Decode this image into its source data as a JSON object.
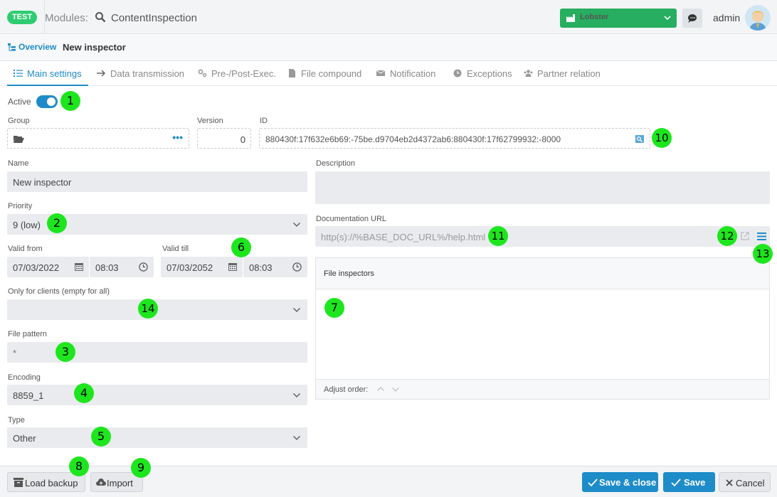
{
  "topbar": {
    "env_badge": "TEST",
    "modules_label": "Modules:",
    "module_name": "ContentInspection",
    "client_selector": "Lobster",
    "user_name": "admin"
  },
  "breadcrumb": {
    "overview": "Overview",
    "current": "New inspector"
  },
  "tabs": [
    {
      "label": "Main settings",
      "active": true
    },
    {
      "label": "Data transmission"
    },
    {
      "label": "Pre-/Post-Exec."
    },
    {
      "label": "File compound"
    },
    {
      "label": "Notification"
    },
    {
      "label": "Exceptions"
    },
    {
      "label": "Partner relation"
    }
  ],
  "form": {
    "active_label": "Active",
    "active": true,
    "group_label": "Group",
    "group_value": "",
    "version_label": "Version",
    "version_value": "0",
    "id_label": "ID",
    "id_value": "880430f:17f632e6b69:-75be.d9704eb2d4372ab6:880430f:17f62799932:-8000",
    "name_label": "Name",
    "name_value": "New inspector",
    "description_label": "Description",
    "description_value": "",
    "priority_label": "Priority",
    "priority_value": "9 (low)",
    "doc_url_label": "Documentation URL",
    "doc_url_placeholder": "http(s)://%BASE_DOC_URL%/help.html",
    "valid_from_label": "Valid from",
    "valid_from_date": "07/03/2022",
    "valid_from_time": "08:03",
    "valid_till_label": "Valid till",
    "valid_till_date": "07/03/2052",
    "valid_till_time": "08:03",
    "clients_label": "Only for clients (empty for all)",
    "clients_value": "",
    "file_pattern_label": "File pattern",
    "file_pattern_value": "*",
    "encoding_label": "Encoding",
    "encoding_value": "8859_1",
    "type_label": "Type",
    "type_value": "Other"
  },
  "file_inspectors": {
    "title": "File inspectors",
    "adjust_order_label": "Adjust order:"
  },
  "markers": [
    "1",
    "2",
    "3",
    "4",
    "5",
    "6",
    "7",
    "8",
    "9",
    "10",
    "11",
    "12",
    "13",
    "14"
  ],
  "footer": {
    "load_backup": "Load backup",
    "import": "Import",
    "save_close": "Save & close",
    "save": "Save",
    "cancel": "Cancel"
  },
  "colors": {
    "accent": "#1e8cc8",
    "client_green": "#27ae60",
    "marker_green": "#1ee61e"
  }
}
